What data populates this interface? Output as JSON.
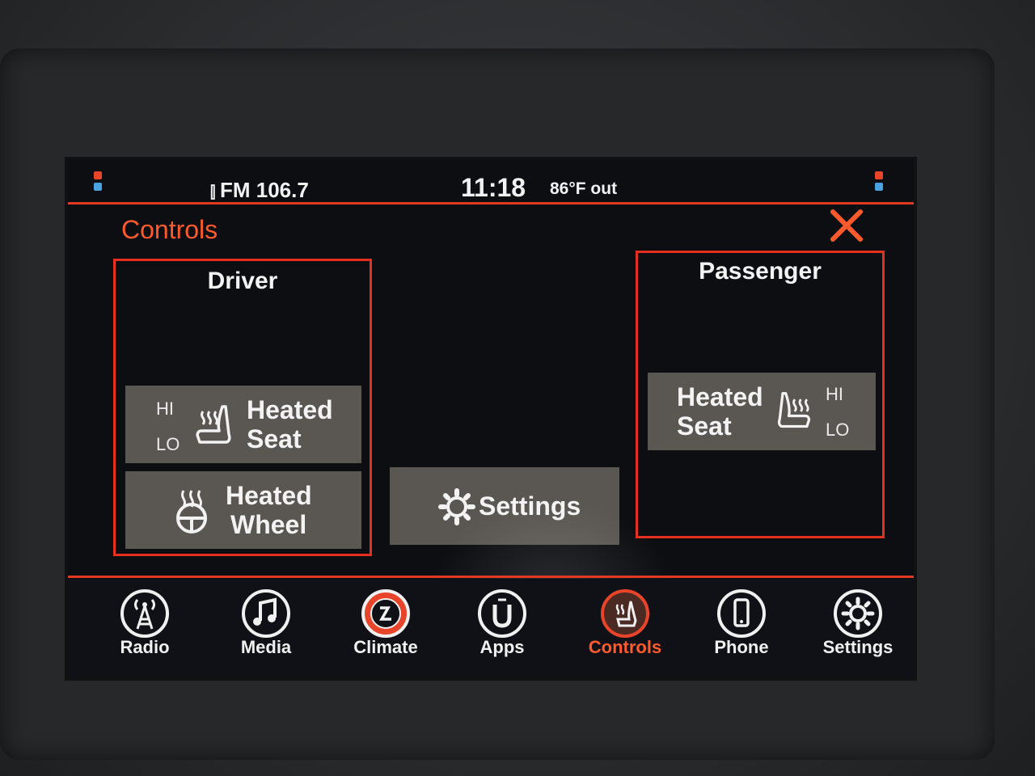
{
  "status": {
    "radio": "FM 106.7",
    "time": "11:18",
    "temperature": "86°F out"
  },
  "page": {
    "title": "Controls"
  },
  "driver": {
    "title": "Driver",
    "heated_seat": {
      "hi": "HI",
      "lo": "LO",
      "line1": "Heated",
      "line2": "Seat"
    },
    "heated_wheel": {
      "line1": "Heated",
      "line2": "Wheel"
    }
  },
  "center": {
    "settings_label": "Settings"
  },
  "passenger": {
    "title": "Passenger",
    "heated_seat": {
      "hi": "HI",
      "lo": "LO",
      "line1": "Heated",
      "line2": "Seat"
    }
  },
  "nav": [
    {
      "label": "Radio",
      "icon": "radio-tower-icon"
    },
    {
      "label": "Media",
      "icon": "music-note-icon"
    },
    {
      "label": "Climate",
      "icon": "climate-icon"
    },
    {
      "label": "Apps",
      "icon": "apps-icon"
    },
    {
      "label": "Controls",
      "icon": "heated-seat-icon",
      "active": true
    },
    {
      "label": "Phone",
      "icon": "phone-icon"
    },
    {
      "label": "Settings",
      "icon": "gear-icon"
    }
  ],
  "colors": {
    "accent": "#ff5a2c",
    "line": "#e53020",
    "tile": "#5a5752"
  }
}
